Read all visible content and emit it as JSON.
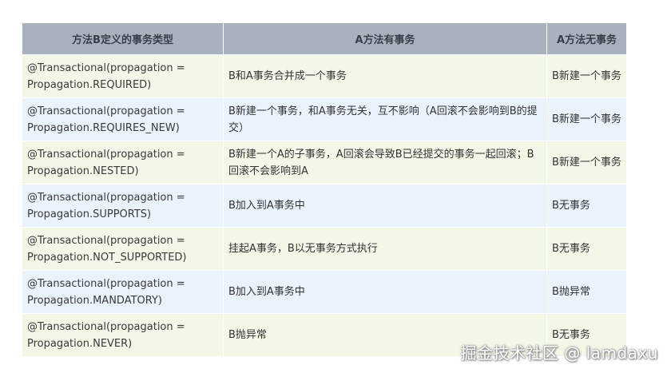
{
  "table": {
    "headers": [
      "方法B定义的事务类型",
      "A方法有事务",
      "A方法无事务"
    ],
    "rows": [
      {
        "b_line1": "@Transactional(propagation =",
        "b_line2": "Propagation.REQUIRED)",
        "a_has": "B和A事务合并成一个事务",
        "a_none": "B新建一个事务"
      },
      {
        "b_line1": "@Transactional(propagation =",
        "b_line2": "Propagation.REQUIRES_NEW)",
        "a_has": "B新建一个事务，和A事务无关，互不影响（A回滚不会影响到B的提交）",
        "a_none": "B新建一个事务"
      },
      {
        "b_line1": "@Transactional(propagation =",
        "b_line2": "Propagation.NESTED)",
        "a_has": "B新建一个A的子事务，A回滚会导致B已经提交的事务一起回滚；B回滚不会影响到A",
        "a_none": "B新建一个事务"
      },
      {
        "b_line1": "@Transactional(propagation =",
        "b_line2": "Propagation.SUPPORTS)",
        "a_has": "B加入到A事务中",
        "a_none": "B无事务"
      },
      {
        "b_line1": "@Transactional(propagation =",
        "b_line2": "Propagation.NOT_SUPPORTED)",
        "a_has": "挂起A事务，B以无事务方式执行",
        "a_none": "B无事务"
      },
      {
        "b_line1": "@Transactional(propagation =",
        "b_line2": "Propagation.MANDATORY)",
        "a_has": "B加入到A事务中",
        "a_none": "B抛异常"
      },
      {
        "b_line1": "@Transactional(propagation =",
        "b_line2": "Propagation.NEVER)",
        "a_has": "B抛异常",
        "a_none": "B无事务"
      }
    ]
  },
  "watermark": "掘金技术社区 @ lamdaxu",
  "colors": {
    "header_bg": "#a9b0be",
    "row_green": "#f1f8e8",
    "row_blue": "#eaf3fc"
  }
}
